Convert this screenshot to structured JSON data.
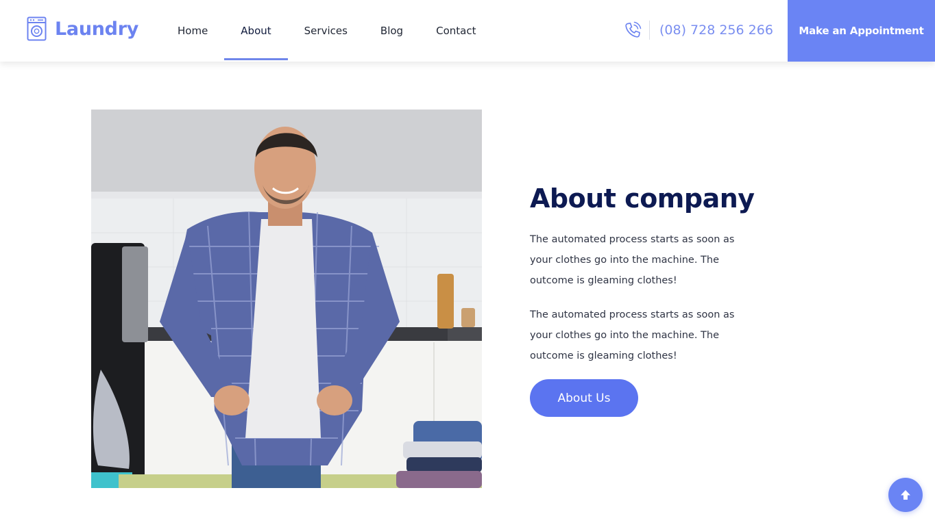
{
  "header": {
    "logo_text": "Laundry",
    "logo_icon": "washing-machine-icon",
    "nav": [
      {
        "label": "Home",
        "active": false
      },
      {
        "label": "About",
        "active": true
      },
      {
        "label": "Services",
        "active": false
      },
      {
        "label": "Blog",
        "active": false
      },
      {
        "label": "Contact",
        "active": false
      }
    ],
    "phone_icon": "phone-icon",
    "phone_number": "(08) 728 256 266",
    "appointment_label": "Make an Appointment"
  },
  "about": {
    "image_alt": "Smiling man in checked shirt standing at an ironing board",
    "title": "About company",
    "paragraphs": [
      "The automated process starts as soon as your clothes go into the machine. The outcome is gleaming clothes!",
      "The automated process starts as soon as your clothes go into the machine. The outcome is gleaming clothes!"
    ],
    "button_label": "About Us"
  },
  "scroll_top_icon": "arrow-up-icon",
  "colors": {
    "accent": "#6a84f4",
    "button": "#5b74f0",
    "title": "#0d1a52",
    "text": "#2f3444",
    "logo": "#6c83f0"
  }
}
